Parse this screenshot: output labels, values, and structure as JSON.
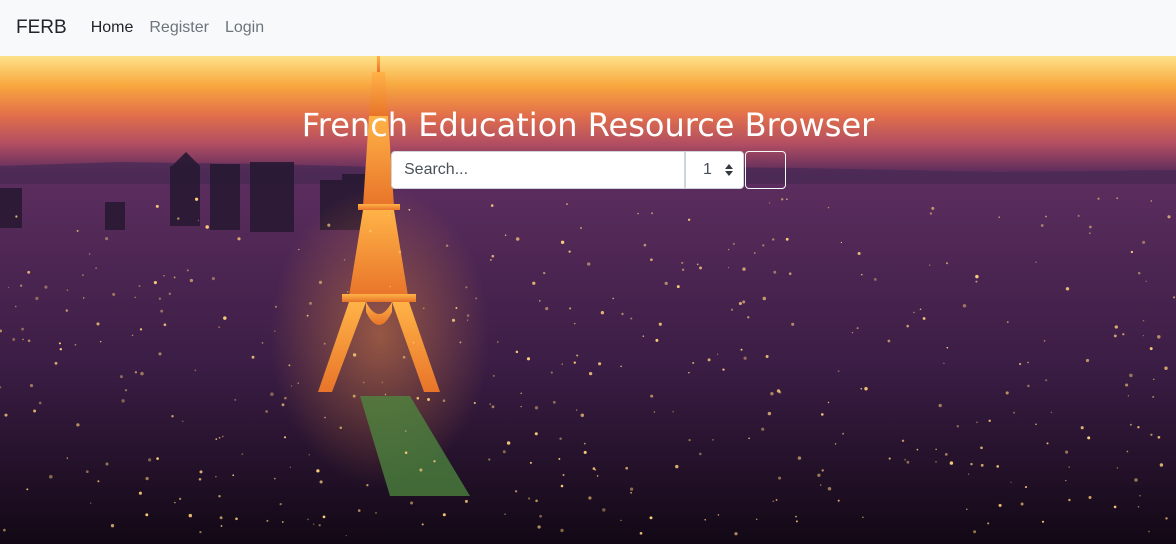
{
  "navbar": {
    "brand": "FERB",
    "links": [
      {
        "label": "Home",
        "active": true
      },
      {
        "label": "Register",
        "active": false
      },
      {
        "label": "Login",
        "active": false
      }
    ]
  },
  "hero": {
    "title": "French Education Resource Browser",
    "background": "paris-eiffel-tower-night-photo"
  },
  "search": {
    "placeholder": "Search...",
    "value": "",
    "page_select_value": "1",
    "button_icon": "search-icon"
  },
  "colors": {
    "navbar_bg": "#f8f9fa",
    "title_text": "#ffffff"
  }
}
